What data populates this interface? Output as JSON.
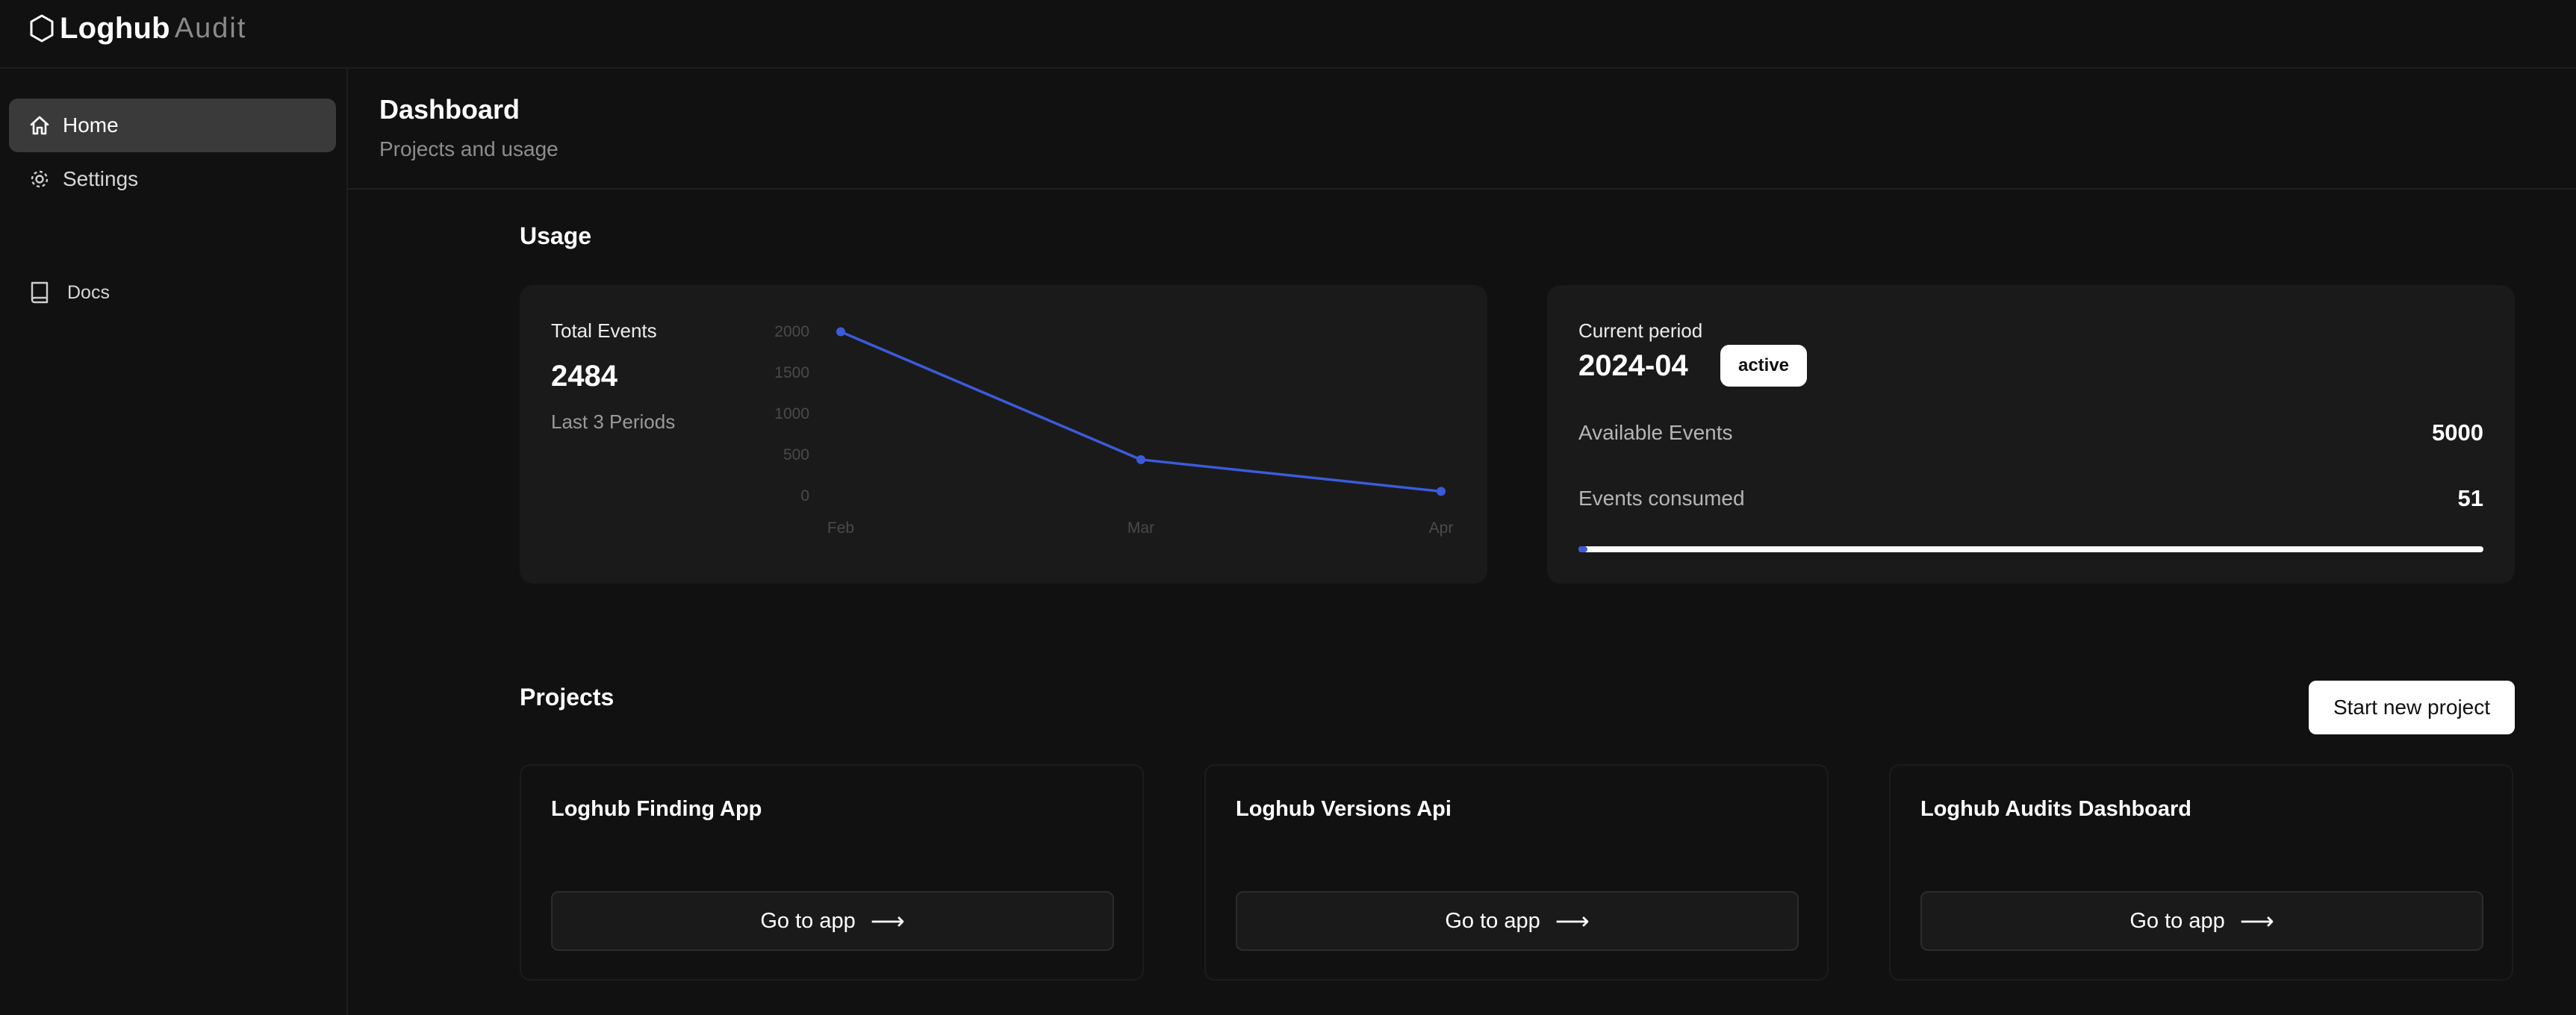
{
  "brand": {
    "name": "Loghub",
    "suffix": "Audit"
  },
  "sidebar": {
    "items": [
      {
        "label": "Home",
        "icon": "home-icon",
        "active": true
      },
      {
        "label": "Settings",
        "icon": "gear-icon",
        "active": false
      },
      {
        "label": "Docs",
        "icon": "book-icon",
        "active": false
      }
    ]
  },
  "header": {
    "title": "Dashboard",
    "subtitle": "Projects and usage"
  },
  "usage": {
    "title": "Usage",
    "total": {
      "label": "Total Events",
      "value": "2484",
      "caption": "Last 3 Periods"
    },
    "current": {
      "label": "Current period",
      "period": "2024-04",
      "status": "active",
      "available_label": "Available Events",
      "available_value": "5000",
      "consumed_label": "Events consumed",
      "consumed_value": "51",
      "progress_fraction": 0.0102
    }
  },
  "chart_data": {
    "type": "line",
    "categories": [
      "Feb",
      "Mar",
      "Apr"
    ],
    "values": [
      1995,
      438,
      51
    ],
    "yticks": [
      0,
      500,
      1000,
      1500,
      2000
    ],
    "ylim": [
      0,
      2000
    ],
    "grid": false,
    "color": "#3b5bdb"
  },
  "projects": {
    "title": "Projects",
    "new_button": "Start new project",
    "items": [
      {
        "name": "Loghub Finding App",
        "button": "Go to app"
      },
      {
        "name": "Loghub Versions Api",
        "button": "Go to app"
      },
      {
        "name": "Loghub Audits Dashboard",
        "button": "Go to app"
      }
    ]
  },
  "colors": {
    "accent": "#3b5bdb",
    "background": "#111111",
    "card": "#1a1a1a"
  }
}
